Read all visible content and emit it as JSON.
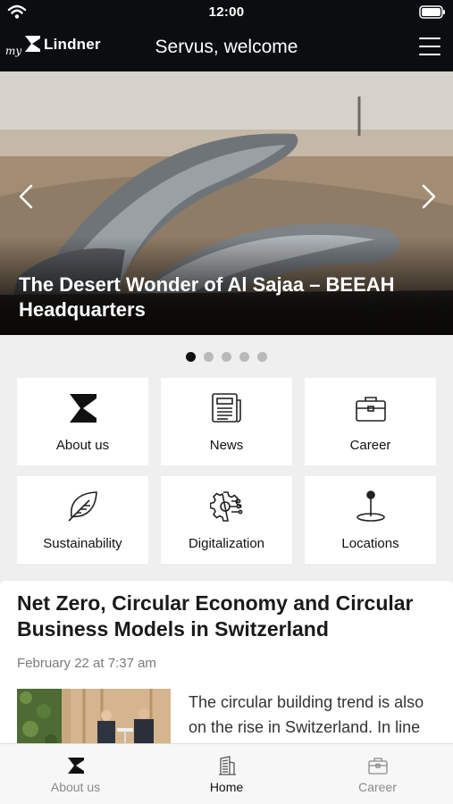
{
  "status_bar": {
    "time": "12:00"
  },
  "header": {
    "logo_prefix": "my",
    "logo_brand": "Lindner",
    "title": "Servus, welcome"
  },
  "hero": {
    "caption": "The Desert Wonder of Al Sajaa – BEEAH Headquarters",
    "slide_count": 5,
    "active_slide": 1
  },
  "tiles": [
    {
      "label": "About us",
      "icon": "lindner-logo-icon"
    },
    {
      "label": "News",
      "icon": "newspaper-icon"
    },
    {
      "label": "Career",
      "icon": "briefcase-icon"
    },
    {
      "label": "Sustainability",
      "icon": "leaf-icon"
    },
    {
      "label": "Digitalization",
      "icon": "gear-circuit-icon"
    },
    {
      "label": "Locations",
      "icon": "location-pin-icon"
    }
  ],
  "article": {
    "headline": "Net Zero, Circular Economy and Circular Business Models in Switzerland",
    "date": "February 22 at 7:37 am",
    "excerpt": "The circular building trend is also on the rise in Switzerland. In line"
  },
  "tabbar": {
    "items": [
      {
        "label": "About us",
        "icon": "lindner-logo-icon",
        "active": false
      },
      {
        "label": "Home",
        "icon": "building-icon",
        "active": true
      },
      {
        "label": "Career",
        "icon": "briefcase-icon",
        "active": false
      }
    ]
  },
  "colors": {
    "header_bg": "#0b0e10",
    "active_tab": "#111111",
    "inactive_tab": "#8a8a8a",
    "page_bg": "#efefef"
  }
}
